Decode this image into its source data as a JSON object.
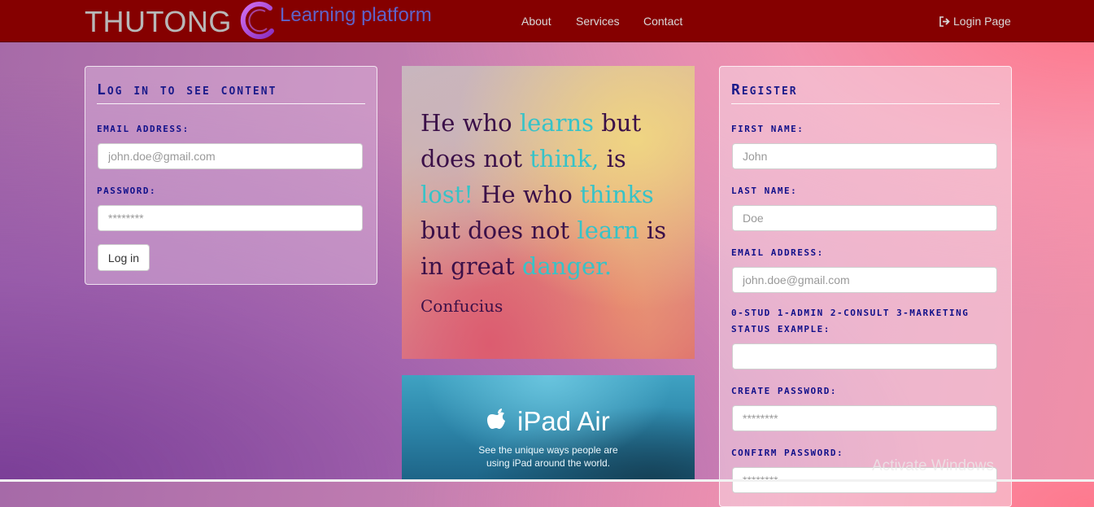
{
  "navbar": {
    "brand": "THUTONG",
    "brand_sub": "Learning platform",
    "links": [
      "About",
      "Services",
      "Contact"
    ],
    "login_link": "Login Page",
    "login_icon": "sign-in-icon",
    "background": "#850000"
  },
  "login_panel": {
    "title": "Log in to see content",
    "email_label": "Email Address:",
    "email_placeholder": "john.doe@gmail.com",
    "password_label": "Password:",
    "password_placeholder": "********",
    "button": "Log in"
  },
  "quote": {
    "segments": [
      {
        "text": "He who ",
        "highlight": false
      },
      {
        "text": "learns",
        "highlight": true
      },
      {
        "text": " but does not ",
        "highlight": false
      },
      {
        "text": "think,",
        "highlight": true
      },
      {
        "text": " is ",
        "highlight": false
      },
      {
        "text": "lost!",
        "highlight": true
      },
      {
        "text": " He who ",
        "highlight": false
      },
      {
        "text": "thinks",
        "highlight": true
      },
      {
        "text": " but does not ",
        "highlight": false
      },
      {
        "text": "learn",
        "highlight": true
      },
      {
        "text": " is in great ",
        "highlight": false
      },
      {
        "text": "danger.",
        "highlight": true
      }
    ],
    "author": "Confucius",
    "highlight_color": "#36c3c8",
    "text_color": "#3b1048"
  },
  "ad": {
    "title": "iPad Air",
    "line1": "See the unique ways people are",
    "line2": "using iPad around the world.",
    "icon": "apple-logo-icon"
  },
  "register_panel": {
    "title": "Register",
    "first_name_label": "First Name:",
    "first_name_placeholder": "John",
    "last_name_label": "Last Name:",
    "last_name_placeholder": "Doe",
    "email_label": "Email Address:",
    "email_placeholder": "john.doe@gmail.com",
    "status_label_line1": "0-stud 1-admin 2-consult 3-marketing",
    "status_label_line2": "Status example:",
    "status_placeholder": "",
    "create_password_label": "Create Password:",
    "create_password_placeholder": "********",
    "confirm_password_label": "Confirm Password:",
    "confirm_password_placeholder": "********"
  },
  "watermark": "Activate Windows",
  "colors": {
    "label_color": "#10108a",
    "title_color": "#1a1a8a",
    "brand_sub_color": "#5f63c8"
  }
}
